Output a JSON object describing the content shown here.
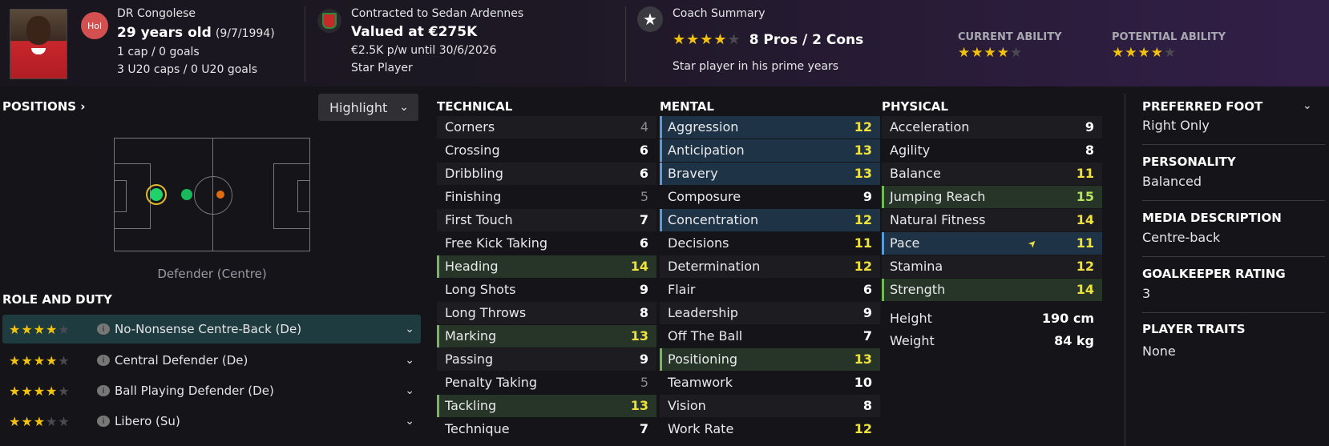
{
  "header": {
    "nationality_badge": "Hol",
    "nationality": "DR Congolese",
    "age": "29 years old",
    "dob": "(9/7/1994)",
    "caps": "1 cap / 0 goals",
    "u20": "3 U20 caps / 0 U20 goals",
    "contract": "Contracted to Sedan Ardennes",
    "value": "Valued at €275K",
    "wage": "€2.5K p/w until 30/6/2026",
    "status": "Star Player",
    "coach_title": "Coach Summary",
    "pros_cons": "8 Pros / 2 Cons",
    "coach_stars": 4,
    "coach_note": "Star player in his prime years",
    "current_ability_label": "CURRENT ABILITY",
    "current_ability_stars": 4,
    "potential_ability_label": "POTENTIAL ABILITY",
    "potential_ability_stars": 4
  },
  "positions": {
    "title": "POSITIONS",
    "highlight_label": "Highlight",
    "position_label": "Defender (Centre)"
  },
  "roles": {
    "title": "ROLE AND DUTY",
    "items": [
      {
        "stars": 4,
        "label": "No-Nonsense Centre-Back (De)"
      },
      {
        "stars": 4,
        "label": "Central Defender (De)"
      },
      {
        "stars": 4,
        "label": "Ball Playing Defender (De)"
      },
      {
        "stars": 3,
        "label": "Libero (Su)"
      }
    ]
  },
  "technical": {
    "title": "TECHNICAL",
    "items": [
      {
        "name": "Corners",
        "value": "4"
      },
      {
        "name": "Crossing",
        "value": "6"
      },
      {
        "name": "Dribbling",
        "value": "6"
      },
      {
        "name": "Finishing",
        "value": "5"
      },
      {
        "name": "First Touch",
        "value": "7"
      },
      {
        "name": "Free Kick Taking",
        "value": "6"
      },
      {
        "name": "Heading",
        "value": "14"
      },
      {
        "name": "Long Shots",
        "value": "9"
      },
      {
        "name": "Long Throws",
        "value": "8"
      },
      {
        "name": "Marking",
        "value": "13"
      },
      {
        "name": "Passing",
        "value": "9"
      },
      {
        "name": "Penalty Taking",
        "value": "5"
      },
      {
        "name": "Tackling",
        "value": "13"
      },
      {
        "name": "Technique",
        "value": "7"
      }
    ]
  },
  "mental": {
    "title": "MENTAL",
    "items": [
      {
        "name": "Aggression",
        "value": "12"
      },
      {
        "name": "Anticipation",
        "value": "13"
      },
      {
        "name": "Bravery",
        "value": "13"
      },
      {
        "name": "Composure",
        "value": "9"
      },
      {
        "name": "Concentration",
        "value": "12"
      },
      {
        "name": "Decisions",
        "value": "11"
      },
      {
        "name": "Determination",
        "value": "12"
      },
      {
        "name": "Flair",
        "value": "6"
      },
      {
        "name": "Leadership",
        "value": "9"
      },
      {
        "name": "Off The Ball",
        "value": "7"
      },
      {
        "name": "Positioning",
        "value": "13"
      },
      {
        "name": "Teamwork",
        "value": "10"
      },
      {
        "name": "Vision",
        "value": "8"
      },
      {
        "name": "Work Rate",
        "value": "12"
      }
    ]
  },
  "physical": {
    "title": "PHYSICAL",
    "items": [
      {
        "name": "Acceleration",
        "value": "9"
      },
      {
        "name": "Agility",
        "value": "8"
      },
      {
        "name": "Balance",
        "value": "11"
      },
      {
        "name": "Jumping Reach",
        "value": "15"
      },
      {
        "name": "Natural Fitness",
        "value": "14"
      },
      {
        "name": "Pace",
        "value": "11"
      },
      {
        "name": "Stamina",
        "value": "12"
      },
      {
        "name": "Strength",
        "value": "14"
      }
    ],
    "height_label": "Height",
    "height_value": "190 cm",
    "weight_label": "Weight",
    "weight_value": "84 kg"
  },
  "info": {
    "foot_title": "PREFERRED FOOT",
    "foot_value": "Right Only",
    "personality_title": "PERSONALITY",
    "personality_value": "Balanced",
    "media_title": "MEDIA DESCRIPTION",
    "media_value": "Centre-back",
    "gk_title": "GOALKEEPER RATING",
    "gk_value": "3",
    "traits_title": "PLAYER TRAITS",
    "traits_value": "None"
  }
}
